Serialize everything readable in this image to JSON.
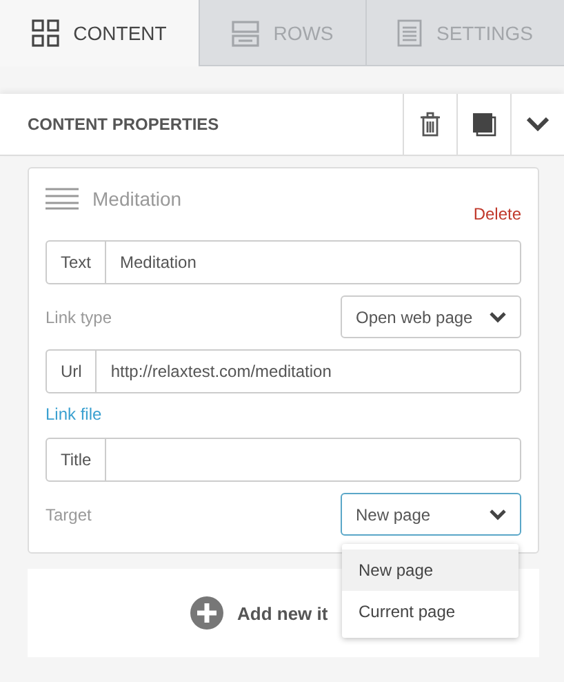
{
  "tabs": [
    {
      "label": "CONTENT",
      "kind": "grid",
      "selected": true
    },
    {
      "label": "ROWS",
      "kind": "rows",
      "selected": false
    },
    {
      "label": "SETTINGS",
      "kind": "doc",
      "selected": false
    }
  ],
  "panel": {
    "title": "CONTENT PROPERTIES"
  },
  "item": {
    "name": "Meditation",
    "delete": "Delete",
    "text_field": {
      "label": "Text",
      "value": "Meditation"
    },
    "link_type": {
      "label": "Link type",
      "value": "Open web page"
    },
    "url_field": {
      "label": "Url",
      "value": "http://relaxtest.com/meditation"
    },
    "link_file": "Link file",
    "title_field": {
      "label": "Title"
    },
    "target": {
      "label": "Target",
      "value": "New page",
      "expanded": true,
      "options": [
        {
          "label": "New page",
          "selected": true
        },
        {
          "label": "Current page",
          "selected": false
        }
      ]
    }
  },
  "add_button": "Add new it"
}
